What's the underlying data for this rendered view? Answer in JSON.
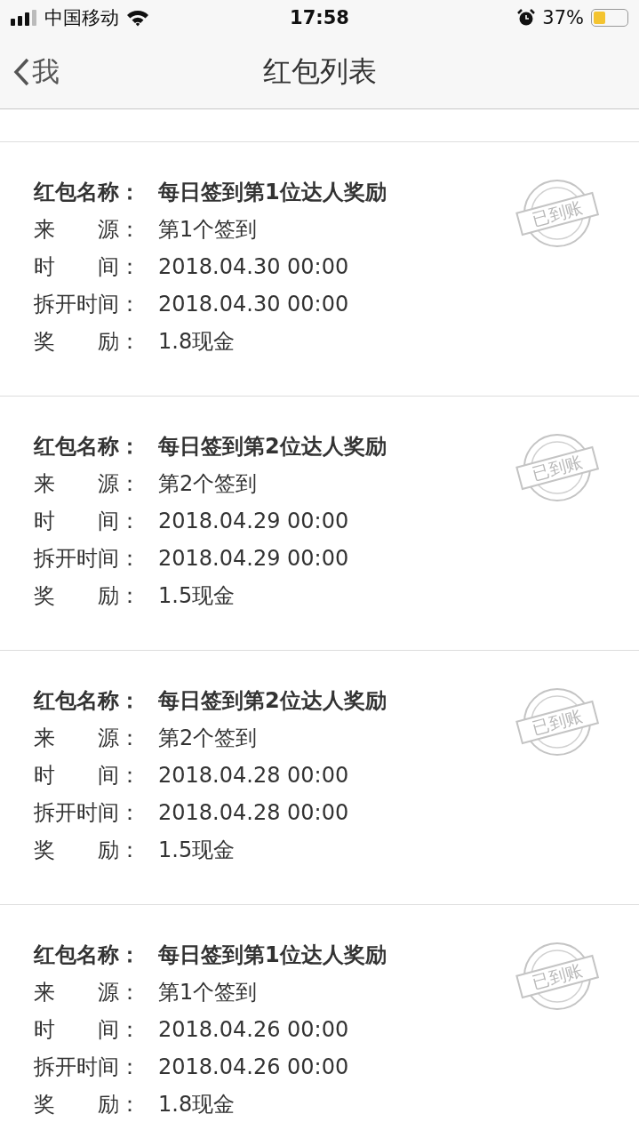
{
  "status_bar": {
    "carrier": "中国移动",
    "time": "17:58",
    "battery": "37%"
  },
  "nav": {
    "back": "我",
    "title": "红包列表"
  },
  "cards": [
    {
      "fields": [
        {
          "label": "红包名称：",
          "value": "每日签到第1位达人奖励",
          "kind": "title"
        },
        {
          "label": "来　　源：",
          "value": "第1个签到",
          "kind": "plain"
        },
        {
          "label": "时　　间：",
          "value": "2018.04.30 00:00",
          "kind": "plain"
        },
        {
          "label": "拆开时间：",
          "value": "2018.04.30 00:00",
          "kind": "plain"
        },
        {
          "label": "奖　　励：",
          "value": "1.8现金",
          "kind": "plain"
        }
      ],
      "stamp": "已到账"
    },
    {
      "fields": [
        {
          "label": "红包名称：",
          "value": "每日签到第2位达人奖励",
          "kind": "title"
        },
        {
          "label": "来　　源：",
          "value": "第2个签到",
          "kind": "plain"
        },
        {
          "label": "时　　间：",
          "value": "2018.04.29 00:00",
          "kind": "plain"
        },
        {
          "label": "拆开时间：",
          "value": "2018.04.29 00:00",
          "kind": "plain"
        },
        {
          "label": "奖　　励：",
          "value": "1.5现金",
          "kind": "plain"
        }
      ],
      "stamp": "已到账"
    },
    {
      "fields": [
        {
          "label": "红包名称：",
          "value": "每日签到第2位达人奖励",
          "kind": "title"
        },
        {
          "label": "来　　源：",
          "value": "第2个签到",
          "kind": "plain"
        },
        {
          "label": "时　　间：",
          "value": "2018.04.28 00:00",
          "kind": "plain"
        },
        {
          "label": "拆开时间：",
          "value": "2018.04.28 00:00",
          "kind": "plain"
        },
        {
          "label": "奖　　励：",
          "value": "1.5现金",
          "kind": "plain"
        }
      ],
      "stamp": "已到账"
    },
    {
      "fields": [
        {
          "label": "红包名称：",
          "value": "每日签到第1位达人奖励",
          "kind": "title"
        },
        {
          "label": "来　　源：",
          "value": "第1个签到",
          "kind": "plain"
        },
        {
          "label": "时　　间：",
          "value": "2018.04.26 00:00",
          "kind": "plain"
        },
        {
          "label": "拆开时间：",
          "value": "2018.04.26 00:00",
          "kind": "plain"
        },
        {
          "label": "奖　　励：",
          "value": "1.8现金",
          "kind": "plain"
        }
      ],
      "stamp": "已到账"
    }
  ]
}
